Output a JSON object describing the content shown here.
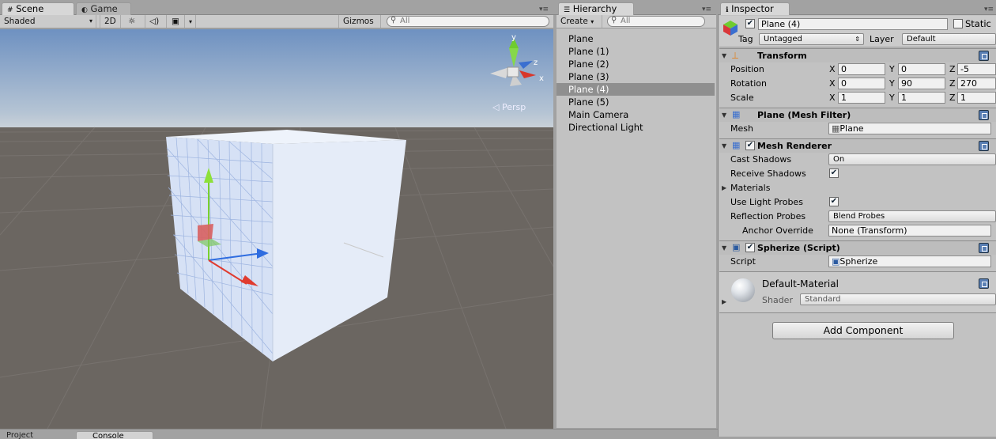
{
  "tabs": {
    "scene": "Scene",
    "game": "Game",
    "hierarchy": "Hierarchy",
    "inspector": "Inspector"
  },
  "scene_toolbar": {
    "shading": "Shaded",
    "mode_2d": "2D",
    "gizmos": "Gizmos",
    "search_placeholder": "All"
  },
  "scene_view": {
    "projection_label": "Persp",
    "axis_labels": {
      "y": "y",
      "z": "z",
      "x": "x"
    }
  },
  "hierarchy": {
    "create": "Create",
    "search_placeholder": "All",
    "items": [
      {
        "label": "Plane",
        "selected": false
      },
      {
        "label": "Plane (1)",
        "selected": false
      },
      {
        "label": "Plane (2)",
        "selected": false
      },
      {
        "label": "Plane (3)",
        "selected": false
      },
      {
        "label": "Plane (4)",
        "selected": true
      },
      {
        "label": "Plane (5)",
        "selected": false
      },
      {
        "label": "Main Camera",
        "selected": false
      },
      {
        "label": "Directional Light",
        "selected": false
      }
    ]
  },
  "inspector": {
    "object_name": "Plane (4)",
    "static_label": "Static",
    "tag_label": "Tag",
    "tag_value": "Untagged",
    "layer_label": "Layer",
    "layer_value": "Default",
    "transform": {
      "title": "Transform",
      "position_label": "Position",
      "rotation_label": "Rotation",
      "scale_label": "Scale",
      "axis_x": "X",
      "axis_y": "Y",
      "axis_z": "Z",
      "position": {
        "x": "0",
        "y": "0",
        "z": "-5"
      },
      "rotation": {
        "x": "0",
        "y": "90",
        "z": "270"
      },
      "scale": {
        "x": "1",
        "y": "1",
        "z": "1"
      }
    },
    "mesh_filter": {
      "title": "Plane (Mesh Filter)",
      "mesh_label": "Mesh",
      "mesh_value": "Plane"
    },
    "mesh_renderer": {
      "title": "Mesh Renderer",
      "cast_shadows_label": "Cast Shadows",
      "cast_shadows_value": "On",
      "receive_shadows_label": "Receive Shadows",
      "materials_label": "Materials",
      "light_probes_label": "Use Light Probes",
      "reflection_probes_label": "Reflection Probes",
      "reflection_probes_value": "Blend Probes",
      "anchor_override_label": "Anchor Override",
      "anchor_override_value": "None (Transform)"
    },
    "spherize": {
      "title": "Spherize (Script)",
      "script_label": "Script",
      "script_value": "Spherize"
    },
    "material": {
      "name": "Default-Material",
      "shader_label": "Shader",
      "shader_value": "Standard"
    },
    "add_component": "Add Component"
  },
  "bottom_tabs": {
    "project": "Project",
    "console": "Console"
  }
}
